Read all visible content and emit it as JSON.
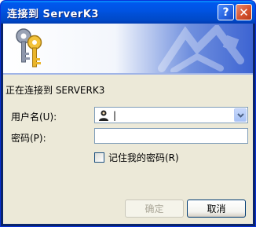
{
  "window": {
    "title": "连接到 ServerK3",
    "help_glyph": "?",
    "close_glyph": "✕"
  },
  "banner": {
    "icon": "keys-icon",
    "art": "network-pattern"
  },
  "body": {
    "connecting_text": "正在连接到 SERVERK3",
    "user_label": "用户名(U):",
    "user_value": "|",
    "user_icon": "user-icon",
    "password_label": "密码(P):",
    "password_value": "",
    "remember_label": "记住我的密码(R)",
    "remember_checked": false
  },
  "buttons": {
    "ok_label": "确定",
    "cancel_label": "取消",
    "ok_enabled": false
  },
  "colors": {
    "titlebar": "#0053e1",
    "dialog_bg": "#ece9d8",
    "close_button": "#d6532f"
  }
}
